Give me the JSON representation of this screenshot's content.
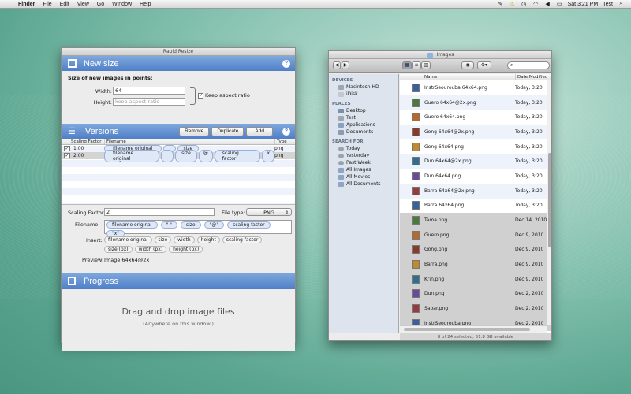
{
  "menubar": {
    "app": "Finder",
    "items": [
      "File",
      "Edit",
      "View",
      "Go",
      "Window",
      "Help"
    ],
    "clock": "Sat 3:21 PM",
    "user": "Test"
  },
  "resize": {
    "title": "Rapid Resize",
    "new_size": {
      "heading": "New size",
      "subtitle": "Size of new images in points:",
      "width_label": "Width:",
      "width_value": "64",
      "height_label": "Height:",
      "height_placeholder": "keep aspect ratio",
      "keep_aspect": "Keep aspect ratio"
    },
    "versions": {
      "heading": "Versions",
      "buttons": [
        "Remove",
        "Duplicate",
        "Add"
      ],
      "columns": [
        "Scaling Factor",
        "Filename",
        "Type"
      ],
      "rows": [
        {
          "factor": "1.00",
          "checked": true,
          "tokens": [
            "filename original",
            "",
            "size"
          ],
          "type": "png"
        },
        {
          "factor": "2.00",
          "checked": true,
          "tokens": [
            "filename original",
            "",
            "size",
            "@",
            "scaling factor",
            "x"
          ],
          "type": "png"
        }
      ],
      "scaling_label": "Scaling Factor:",
      "scaling_value": "2",
      "filetype_label": "File type:",
      "filetype_value": "PNG",
      "filename_label": "Filename:",
      "filename_tokens": [
        "filename original",
        "\" \"",
        "size",
        "\"@\"",
        "scaling factor",
        "\"x\""
      ],
      "insert_label": "Insert:",
      "insert_tokens": [
        "filename original",
        "size",
        "width",
        "height",
        "scaling factor",
        "size (px)",
        "width (px)",
        "height (px)"
      ],
      "preview_label": "Preview:",
      "preview_value": "Image 64x64@2x"
    },
    "progress": {
      "heading": "Progress",
      "drop_title": "Drag and drop image files",
      "drop_sub": "(Anywhere on this window.)"
    }
  },
  "finder": {
    "title": "Images",
    "sidebar": [
      {
        "header": "DEVICES",
        "items": [
          "Macintosh HD",
          "iDisk"
        ]
      },
      {
        "header": "PLACES",
        "items": [
          "Desktop",
          "Test",
          "Applications",
          "Documents"
        ]
      },
      {
        "header": "SEARCH FOR",
        "items": [
          "Today",
          "Yesterday",
          "Past Week",
          "All Images",
          "All Movies",
          "All Documents"
        ]
      }
    ],
    "columns": {
      "name": "Name",
      "date": "Date Modified"
    },
    "files": [
      {
        "name": "InstrSeourouba 64x64.png",
        "date": "Today, 3:20",
        "selected": false
      },
      {
        "name": "Guero 64x64@2x.png",
        "date": "Today, 3:20",
        "selected": false
      },
      {
        "name": "Guero 64x64.png",
        "date": "Today, 3:20",
        "selected": false
      },
      {
        "name": "Gong 64x64@2x.png",
        "date": "Today, 3:20",
        "selected": false
      },
      {
        "name": "Gong 64x64.png",
        "date": "Today, 3:20",
        "selected": false
      },
      {
        "name": "Dun 64x64@2x.png",
        "date": "Today, 3:20",
        "selected": false
      },
      {
        "name": "Dun 64x64.png",
        "date": "Today, 3:20",
        "selected": false
      },
      {
        "name": "Barra 64x64@2x.png",
        "date": "Today, 3:20",
        "selected": false
      },
      {
        "name": "Barra 64x64.png",
        "date": "Today, 3:20",
        "selected": false
      },
      {
        "name": "Tama.png",
        "date": "Dec 14, 2010",
        "selected": true
      },
      {
        "name": "Guero.png",
        "date": "Dec 9, 2010",
        "selected": true
      },
      {
        "name": "Gong.png",
        "date": "Dec 9, 2010",
        "selected": true
      },
      {
        "name": "Barra.png",
        "date": "Dec 9, 2010",
        "selected": true
      },
      {
        "name": "Krin.png",
        "date": "Dec 9, 2010",
        "selected": true
      },
      {
        "name": "Dun.png",
        "date": "Dec 2, 2010",
        "selected": true
      },
      {
        "name": "Sabar.png",
        "date": "Dec 2, 2010",
        "selected": true
      },
      {
        "name": "InstrSeourouba.png",
        "date": "Dec 2, 2010",
        "selected": true
      }
    ],
    "status": "8 of 24 selected, 51.8 GB available"
  }
}
